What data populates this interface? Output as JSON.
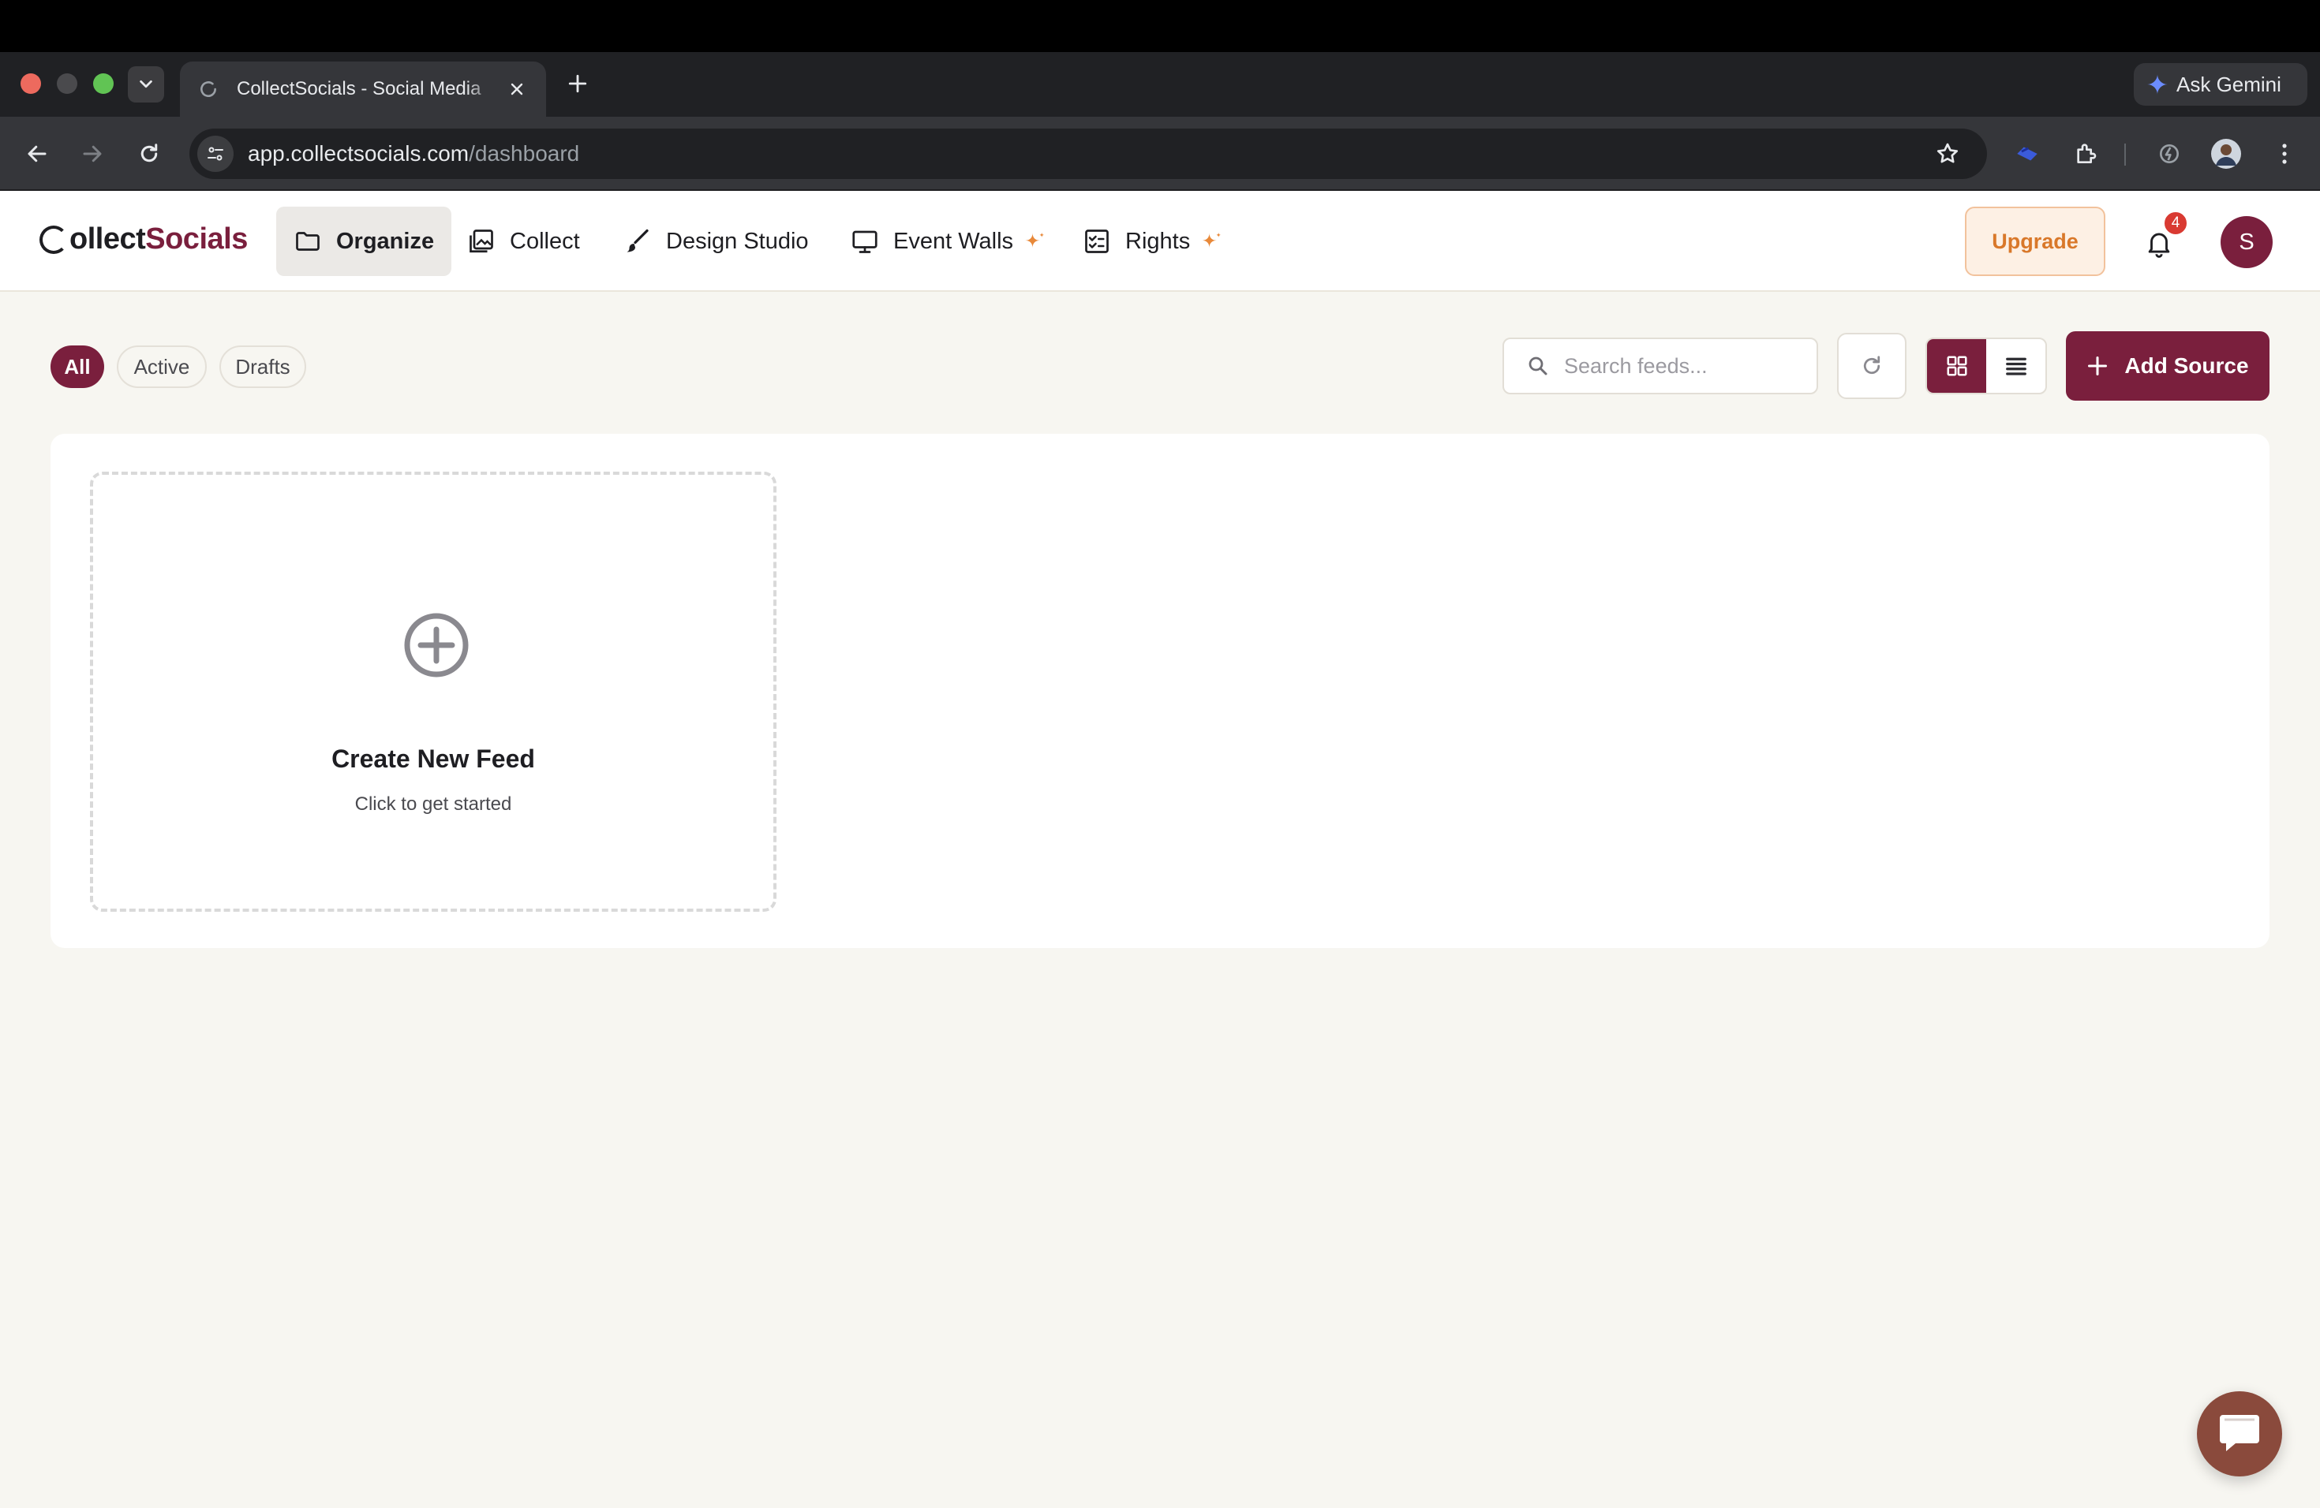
{
  "browser": {
    "tab_title": "CollectSocials - Social Media",
    "gemini_label": "Ask Gemini",
    "url_host": "app.collectsocials.com",
    "url_path": "/dashboard"
  },
  "app": {
    "logo_prefix": "ollect",
    "logo_accent": "Socials",
    "nav": [
      {
        "label": "Organize",
        "icon": "folder-icon",
        "active": true
      },
      {
        "label": "Collect",
        "icon": "images-icon",
        "active": false
      },
      {
        "label": "Design Studio",
        "icon": "brush-icon",
        "active": false
      },
      {
        "label": "Event Walls",
        "icon": "monitor-icon",
        "active": false,
        "sparkle": true
      },
      {
        "label": "Rights",
        "icon": "checklist-icon",
        "active": false,
        "sparkle": true
      }
    ],
    "upgrade_label": "Upgrade",
    "notification_count": "4",
    "avatar_initial": "S"
  },
  "toolbar": {
    "filters": [
      {
        "label": "All",
        "selected": true
      },
      {
        "label": "Active",
        "selected": false
      },
      {
        "label": "Drafts",
        "selected": false
      }
    ],
    "search_placeholder": "Search feeds...",
    "add_source_label": "Add Source",
    "view_mode": "grid"
  },
  "content": {
    "create_title": "Create New Feed",
    "create_subtitle": "Click to get started"
  },
  "colors": {
    "brand": "#7a1f3d",
    "upgrade_text": "#d9782a",
    "sparkle": "#e8893a",
    "badge": "#d93a32"
  }
}
